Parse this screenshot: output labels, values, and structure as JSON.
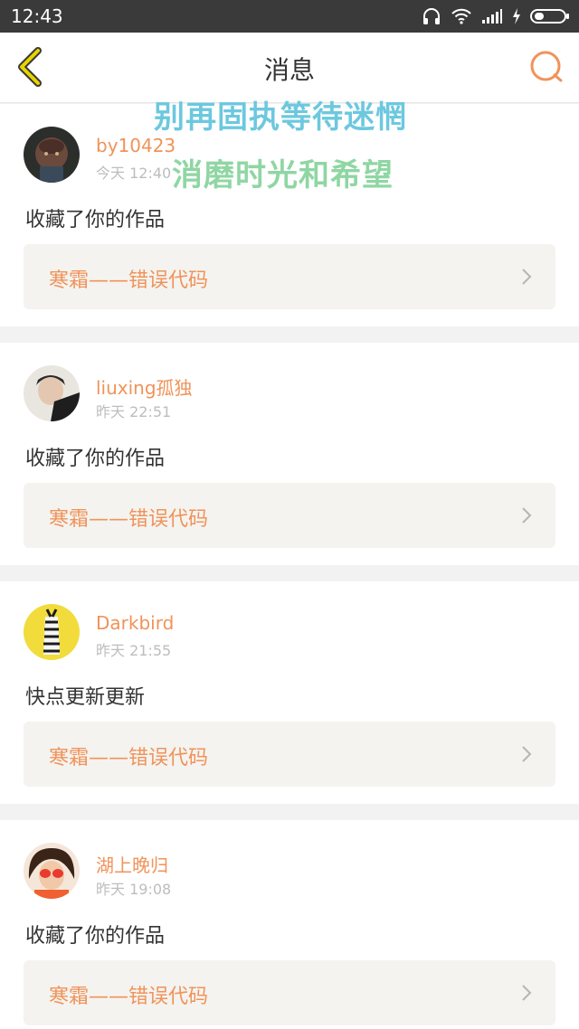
{
  "status_bar": {
    "time": "12:43"
  },
  "header": {
    "title": "消息"
  },
  "overlay": {
    "line1": "别再固执等待迷惘",
    "line2": "消磨时光和希望"
  },
  "messages": [
    {
      "username": "by10423",
      "time": "今天 12:40",
      "text": "收藏了你的作品",
      "work": "寒霜——错误代码"
    },
    {
      "username": "liuxing孤独",
      "time": "昨天 22:51",
      "text": "收藏了你的作品",
      "work": "寒霜——错误代码"
    },
    {
      "username": "Darkbird",
      "time": "昨天 21:55",
      "text": "快点更新更新",
      "work": "寒霜——错误代码"
    },
    {
      "username": "湖上晚归",
      "time": "昨天 19:08",
      "text": "收藏了你的作品",
      "work": "寒霜——错误代码"
    }
  ],
  "colors": {
    "accent": "#f0935a",
    "back_icon": "#e7d400",
    "status_bar": "#3a3a3a",
    "overlay1": "#6cc8df",
    "overlay2": "#8fd6a3"
  }
}
